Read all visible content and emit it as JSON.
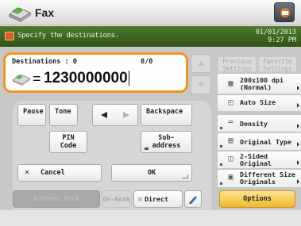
{
  "header": {
    "title": "Fax",
    "fax_icon": "fax-machine-icon",
    "monitor_icon": "status-monitor-icon"
  },
  "status": {
    "message": "Specify the destinations.",
    "date": "01/01/2013",
    "time": "9:27 PM",
    "alert_icon": "alert-icon"
  },
  "destination": {
    "label": "Destinations : 0",
    "count": "0/0",
    "number": "1230000000",
    "prefix": "="
  },
  "keypad": {
    "pause": "Pause",
    "tone": "Tone",
    "backspace": "Backspace",
    "pin_code": "PIN\nCode",
    "sub_address": "Sub-\naddress",
    "cancel": "Cancel",
    "ok": "OK"
  },
  "tabs": {
    "previous": "Previous\nSettings",
    "favorite": "Favorite\nSettings"
  },
  "options": [
    {
      "label": "200x100 dpi\n(Normal)",
      "icon": "resolution-icon"
    },
    {
      "label": "Auto Size",
      "icon": "scan-size-icon"
    },
    {
      "label": "Density",
      "icon": "density-icon"
    },
    {
      "label": "Original Type",
      "icon": "original-type-icon"
    },
    {
      "label": "2-Sided\nOriginal",
      "icon": "two-sided-icon"
    },
    {
      "label": "Different Size\nOriginals",
      "icon": "different-size-icon"
    }
  ],
  "footer": {
    "address_book": "Address Book",
    "on_hook": "On-Hook",
    "direct_send": "Direct Send",
    "options": "Options"
  },
  "colors": {
    "accent": "#f0961e",
    "status_bar": "#3c6322",
    "options_button": "#f5c842"
  }
}
